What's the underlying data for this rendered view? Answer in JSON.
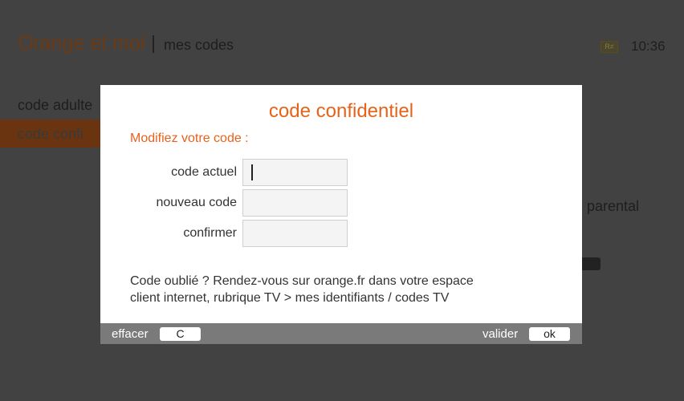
{
  "background": {
    "brand": "Orange et moi",
    "section": "mes codes",
    "badge_icon": "ratio-badge-icon",
    "badge_text": "R≠",
    "clock": "10:36",
    "menu_items": [
      "code adulte",
      "code confi"
    ],
    "right_text": "le parental"
  },
  "dialog": {
    "title": "code confidentiel",
    "subtitle": "Modifiez votre code :",
    "fields": [
      {
        "label": "code actuel",
        "value": ""
      },
      {
        "label": "nouveau code",
        "value": ""
      },
      {
        "label": "confirmer",
        "value": ""
      }
    ],
    "help_line1": "Code oublié ? Rendez-vous sur orange.fr dans votre espace",
    "help_line2": "client internet, rubrique TV > mes identifiants / codes TV",
    "footer": {
      "clear_label": "effacer",
      "clear_key": "C",
      "validate_label": "valider",
      "validate_key": "ok"
    }
  },
  "colors": {
    "accent": "#e8621a",
    "dialog_bg": "#ffffff",
    "footer_bg": "#7a7a7a",
    "overlay_bg": "#424242"
  }
}
